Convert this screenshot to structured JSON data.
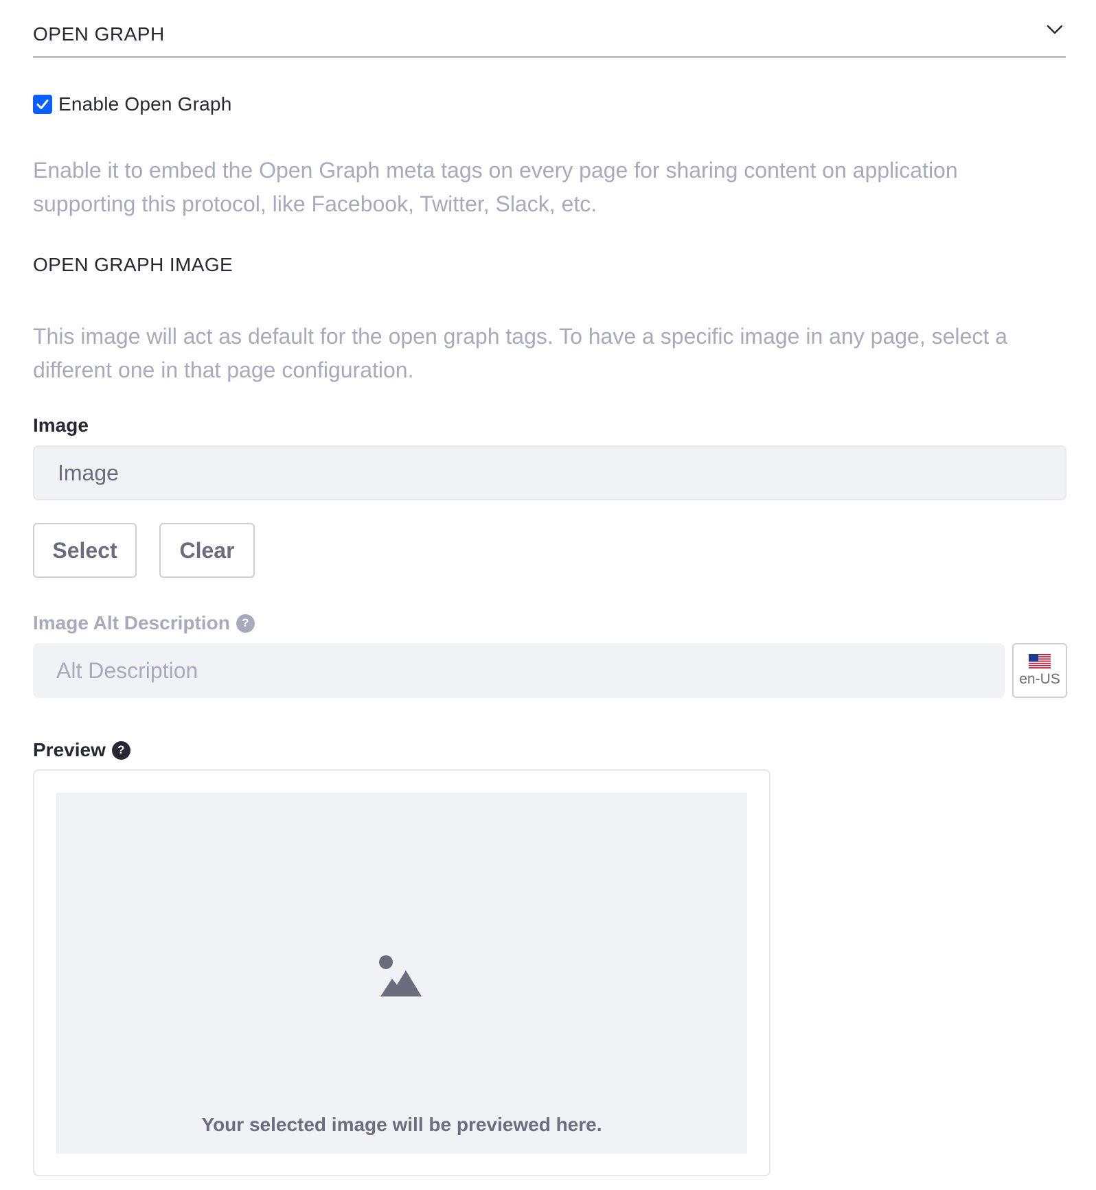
{
  "section": {
    "title": "OPEN GRAPH",
    "toggle_icon": "chevron-down-icon"
  },
  "enable_open_graph": {
    "label": "Enable Open Graph",
    "checked": true,
    "help": "Enable it to embed the Open Graph meta tags on every page for sharing content on application supporting this protocol, like Facebook, Twitter, Slack, etc."
  },
  "og_image": {
    "heading": "OPEN GRAPH IMAGE",
    "help": "This image will act as default for the open graph tags. To have a specific image in any page, select a different one in that page configuration.",
    "label": "Image",
    "value": "Image",
    "select_label": "Select",
    "clear_label": "Clear"
  },
  "alt_description": {
    "label": "Image Alt Description",
    "help_icon": "?",
    "placeholder": "Alt Description",
    "locale": "en-US",
    "locale_icon": "us-flag-icon"
  },
  "preview": {
    "label": "Preview",
    "help_icon": "?",
    "placeholder_icon": "image-icon",
    "caption": "Your selected image will be previewed here."
  },
  "colors": {
    "primary": "#0b5fff",
    "muted_text": "#a7a9bc",
    "body_text": "#272833",
    "secondary_text": "#6b6c7e",
    "input_bg": "#f1f2f5"
  }
}
